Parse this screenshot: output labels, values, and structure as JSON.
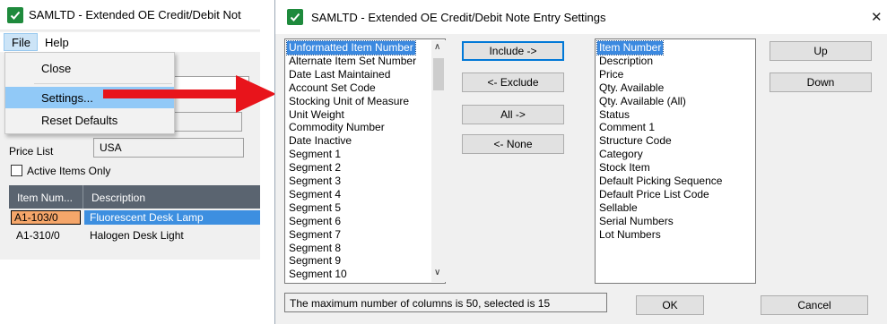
{
  "back_window": {
    "title": "SAMLTD - Extended OE Credit/Debit Not",
    "menu": {
      "file": "File",
      "help": "Help"
    },
    "price_list_label": "Price List",
    "price_list_value": "USA",
    "active_items_label": "Active Items Only",
    "active_items_checked": false,
    "grid": {
      "columns": [
        "Item Num...",
        "Description"
      ],
      "rows": [
        {
          "item": "A1-103/0",
          "description": "Fluorescent Desk Lamp"
        },
        {
          "item": "A1-310/0",
          "description": "Halogen Desk Light"
        }
      ]
    }
  },
  "file_menu": {
    "items": [
      "Close",
      "Settings...",
      "Reset Defaults"
    ],
    "highlighted": "Settings..."
  },
  "dialog": {
    "title": "SAMLTD - Extended OE Credit/Debit Note Entry Settings",
    "close_glyph": "✕",
    "available_columns": [
      "Unformatted Item Number",
      "Alternate Item Set Number",
      "Date Last Maintained",
      "Account Set Code",
      "Stocking Unit of Measure",
      "Unit Weight",
      "Commodity Number",
      "Date Inactive",
      "Segment 1",
      "Segment 2",
      "Segment 3",
      "Segment 4",
      "Segment 5",
      "Segment 6",
      "Segment 7",
      "Segment 8",
      "Segment 9",
      "Segment 10"
    ],
    "available_selected_index": 0,
    "selected_columns": [
      "Item Number",
      "Description",
      "Price",
      "Qty. Available",
      "Qty. Available (All)",
      "Status",
      "Comment 1",
      "Structure Code",
      "Category",
      "Stock Item",
      "Default Picking Sequence",
      "Default Price List Code",
      "Sellable",
      "Serial Numbers",
      "Lot Numbers"
    ],
    "selected_selected_index": 0,
    "buttons": {
      "include": "Include ->",
      "exclude": "<- Exclude",
      "all": "All ->",
      "none": "<- None",
      "up": "Up",
      "down": "Down",
      "ok": "OK",
      "cancel": "Cancel"
    },
    "status": "The maximum number of columns is 50, selected is 15"
  },
  "colors": {
    "app_icon": "#1e8a3c",
    "selection": "#3b89e0",
    "menu_highlight": "#91c9f7",
    "arrow": "#e8141b",
    "grid_header": "#5a6470",
    "row_current": "#f5a66a"
  },
  "icons": [
    "app-check-icon",
    "chevron-down-icon",
    "close-icon",
    "scroll-up-icon",
    "scroll-down-icon",
    "red-arrow"
  ]
}
